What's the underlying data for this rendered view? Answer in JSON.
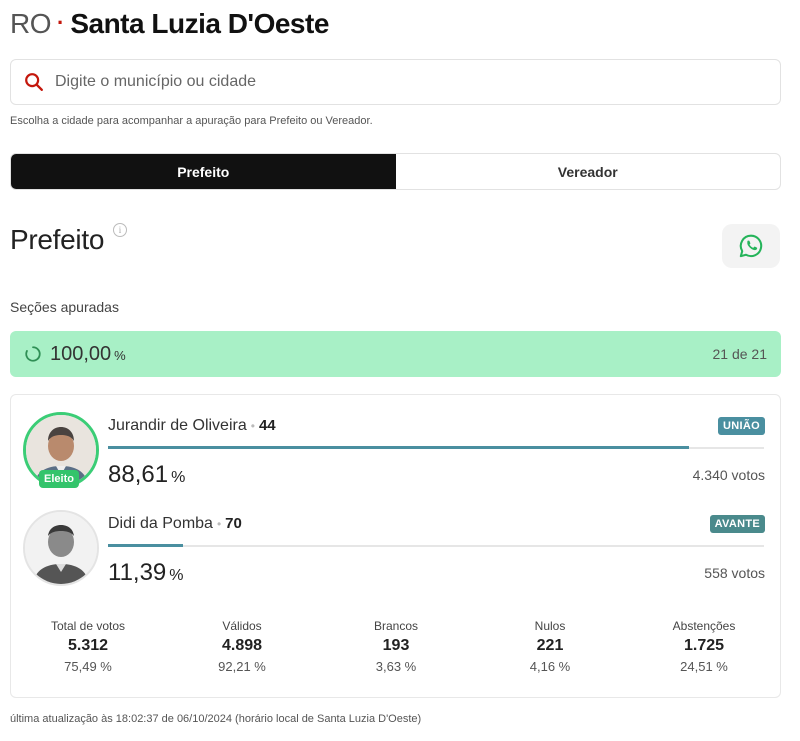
{
  "header": {
    "uf": "RO",
    "separator": "·",
    "city": "Santa Luzia D'Oeste"
  },
  "search": {
    "placeholder": "Digite o município ou cidade"
  },
  "hint": "Escolha a cidade para acompanhar a apuração para Prefeito ou Vereador.",
  "tabs": [
    {
      "label": "Prefeito",
      "active": true
    },
    {
      "label": "Vereador",
      "active": false
    }
  ],
  "section_title": "Prefeito",
  "info_glyph": "i",
  "sections": {
    "label": "Seções apuradas",
    "percent": "100,00",
    "percent_unit": "%",
    "count": "21 de 21"
  },
  "candidates": [
    {
      "name": "Jurandir de Oliveira",
      "number": "44",
      "party": "UNIÃO",
      "party_color": "#4a8fa0",
      "percent": "88,61",
      "percent_value": 88.61,
      "percent_unit": "%",
      "votes": "4.340 votos",
      "elected_label": "Eleito"
    },
    {
      "name": "Didi da Pomba",
      "number": "70",
      "party": "AVANTE",
      "party_color": "#4a8a8c",
      "percent": "11,39",
      "percent_value": 11.39,
      "percent_unit": "%",
      "votes": "558 votos"
    }
  ],
  "stats": [
    {
      "label": "Total de votos",
      "value": "5.312",
      "pct": "75,49 %"
    },
    {
      "label": "Válidos",
      "value": "4.898",
      "pct": "92,21 %"
    },
    {
      "label": "Brancos",
      "value": "193",
      "pct": "3,63 %"
    },
    {
      "label": "Nulos",
      "value": "221",
      "pct": "4,16 %"
    },
    {
      "label": "Abstenções",
      "value": "1.725",
      "pct": "24,51 %"
    }
  ],
  "footer": "última atualização às 18:02:37 de 06/10/2024 (horário local de Santa Luzia D'Oeste)",
  "colors": {
    "accent_red": "#c4170c",
    "progress_bg": "#a8f0c6",
    "elected_green": "#33c46b",
    "bar_fill": "#4a8fa0"
  },
  "icons": {
    "search": "search-icon",
    "info": "info-icon",
    "share": "whatsapp-icon",
    "progress": "spinner-icon"
  }
}
